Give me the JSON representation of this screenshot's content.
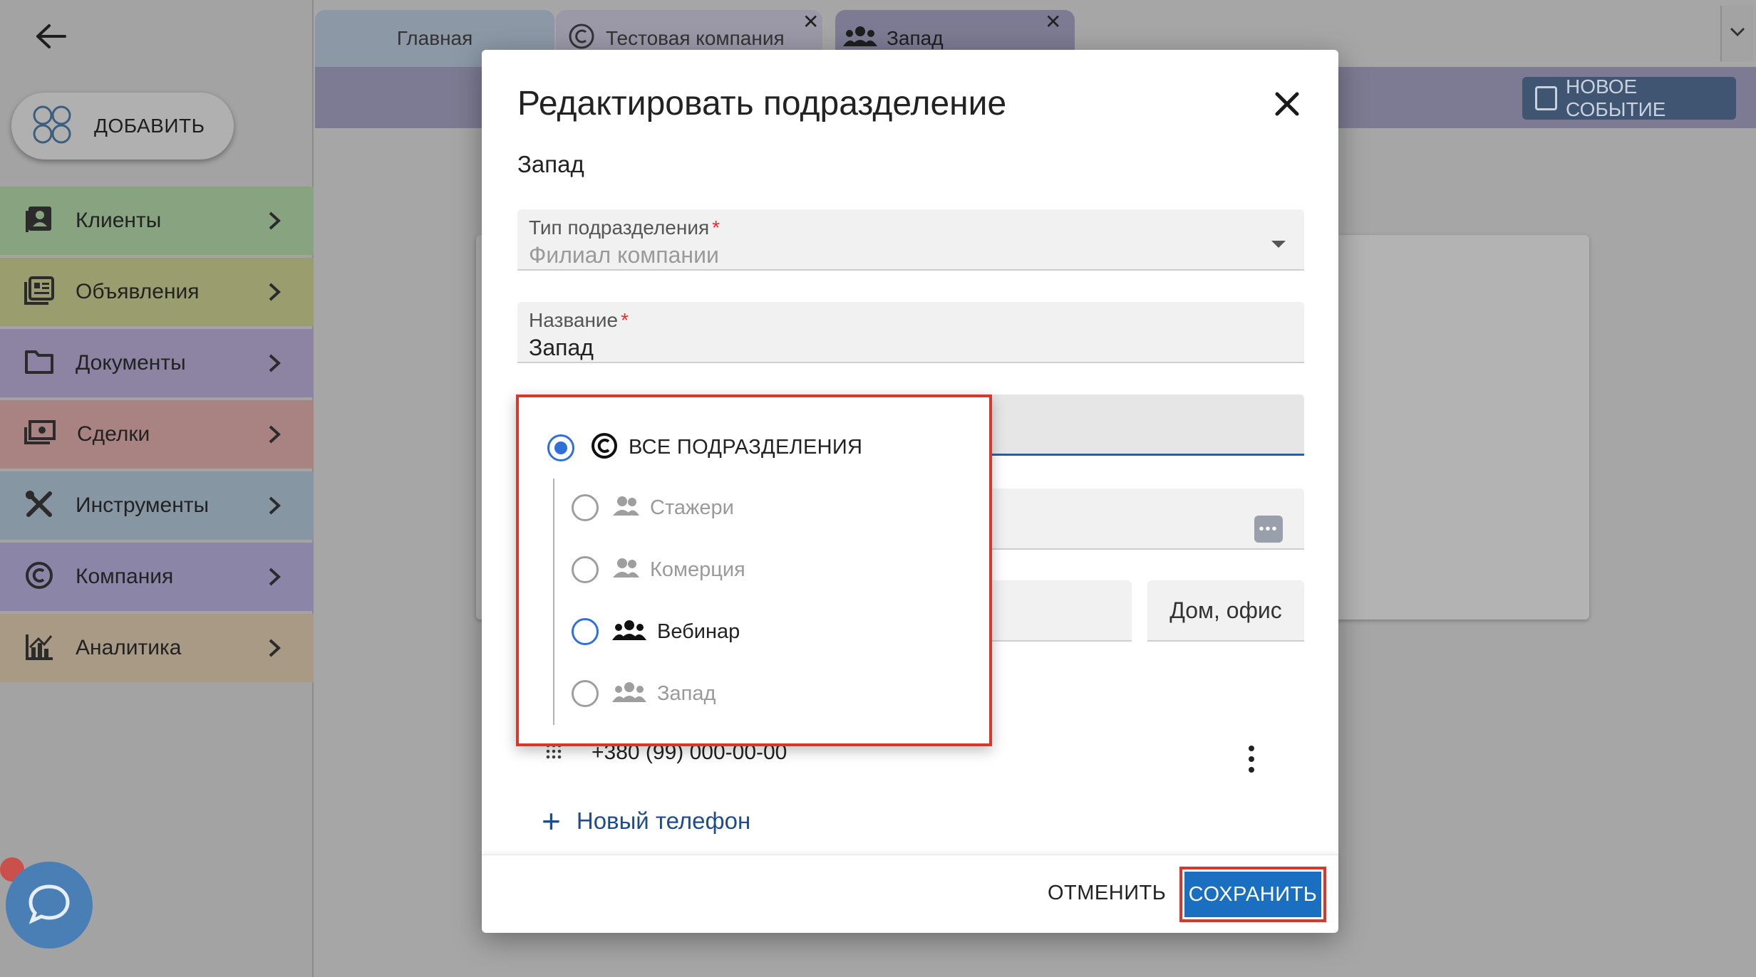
{
  "sidebar": {
    "add_label": "ДОБАВИТЬ",
    "items": [
      {
        "label": "Клиенты",
        "icon": "clients-icon",
        "color": "#87a37f"
      },
      {
        "label": "Объявления",
        "icon": "ads-icon",
        "color": "#9a9d6e"
      },
      {
        "label": "Документы",
        "icon": "folder-icon",
        "color": "#8d84a3"
      },
      {
        "label": "Сделки",
        "icon": "deals-icon",
        "color": "#a98381"
      },
      {
        "label": "Инструменты",
        "icon": "tools-icon",
        "color": "#8696a3"
      },
      {
        "label": "Компания",
        "icon": "company-icon",
        "color": "#8b86a8"
      },
      {
        "label": "Аналитика",
        "icon": "analytics-icon",
        "color": "#a89a84"
      }
    ]
  },
  "tabs": [
    {
      "label": "Главная"
    },
    {
      "label": "Тестовая компания"
    },
    {
      "label": "Запад"
    }
  ],
  "toolbar": {
    "new_event_label": "НОВОЕ СОБЫТИЕ"
  },
  "modal": {
    "title": "Редактировать подразделение",
    "subtitle": "Запад",
    "type_field": {
      "label": "Тип подразделения",
      "value": "Филиал компании"
    },
    "name_field": {
      "label": "Название",
      "value": "Запад"
    },
    "address_type": "Дом, офис",
    "phone": "+380 (99) 000-00-00",
    "new_phone_label": "Новый телефон",
    "cancel_label": "ОТМЕНИТЬ",
    "save_label": "СОХРАНИТЬ",
    "required_mark": "*"
  },
  "tree": {
    "root_label": "ВСЕ ПОДРАЗДЕЛЕНИЯ",
    "items": [
      {
        "label": "Стажери",
        "state": "disabled"
      },
      {
        "label": "Комерция",
        "state": "disabled"
      },
      {
        "label": "Вебинар",
        "state": "focused"
      },
      {
        "label": "Запад",
        "state": "disabled"
      }
    ]
  },
  "colors": {
    "accent": "#1a6fc0",
    "radio_selected": "#2f6fdc",
    "highlight": "#d9372b"
  }
}
